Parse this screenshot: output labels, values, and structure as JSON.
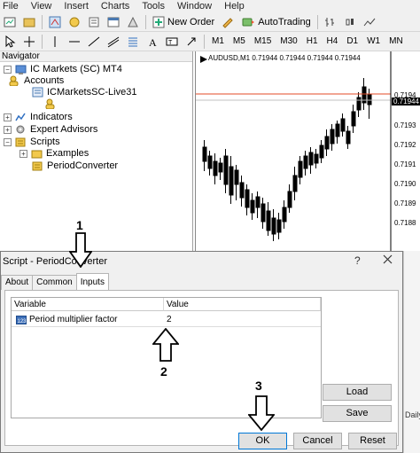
{
  "menu": [
    "File",
    "View",
    "Insert",
    "Charts",
    "Tools",
    "Window",
    "Help"
  ],
  "toolbar": {
    "new_order": "New Order",
    "autotrading": "AutoTrading"
  },
  "timeframes": [
    "M1",
    "M5",
    "M15",
    "M30",
    "H1",
    "H4",
    "D1",
    "W1",
    "MN"
  ],
  "navigator": {
    "title": "Navigator",
    "root": "IC Markets (SC) MT4",
    "accounts": "Accounts",
    "account": "ICMarketsSC-Live31",
    "indicators": "Indicators",
    "experts": "Expert Advisors",
    "scripts": "Scripts",
    "examples": "Examples",
    "period_converter": "PeriodConverter"
  },
  "chart": {
    "header": "AUDUSD,M1  0.71944 0.71944 0.71944 0.71944",
    "price_labels": [
      "0.7194",
      "0.71944",
      "0.7193",
      "0.7192",
      "0.7191",
      "0.7190",
      "0.7189",
      "0.7188"
    ],
    "colors": {
      "bid_line": "#e34b27",
      "price_tag": "#000000"
    }
  },
  "dialog": {
    "title": "Script - PeriodConverter",
    "tabs": [
      "About",
      "Common",
      "Inputs"
    ],
    "active_tab": "Inputs",
    "columns": [
      "Variable",
      "Value"
    ],
    "rows": [
      {
        "variable": "Period multiplier factor",
        "value": "2"
      }
    ],
    "buttons": {
      "load": "Load",
      "save": "Save",
      "ok": "OK",
      "cancel": "Cancel",
      "reset": "Reset"
    }
  },
  "annotations": [
    "1",
    "2",
    "3"
  ],
  "background_text": "Daily"
}
